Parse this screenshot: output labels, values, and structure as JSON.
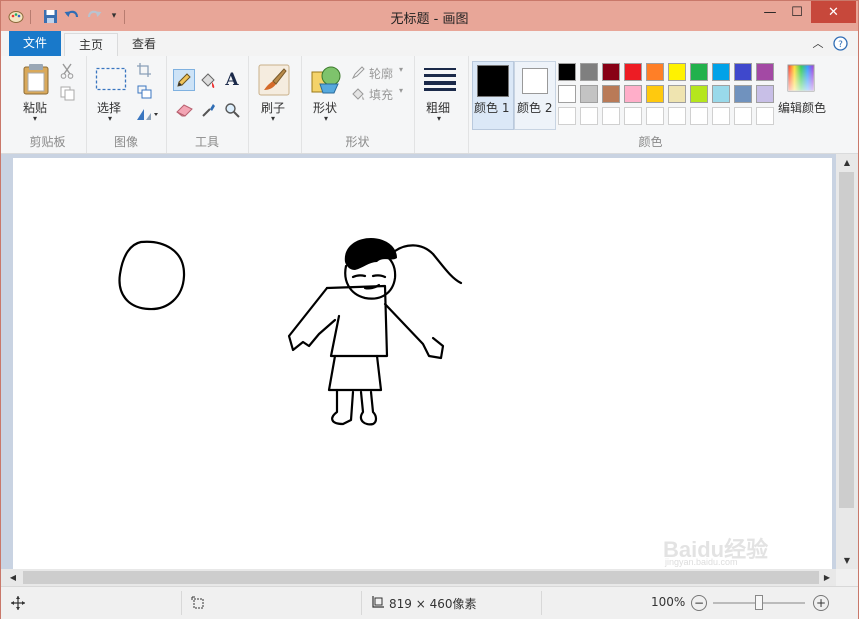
{
  "window": {
    "title": "无标题 - 画图"
  },
  "quick_access": {
    "app_icon": "paint-icon",
    "items": [
      "save-icon",
      "undo-icon",
      "redo-icon",
      "customize-icon"
    ]
  },
  "controls": {
    "minimize": "—",
    "maximize": "☐",
    "close": "✕"
  },
  "tabs": {
    "file": "文件",
    "home": "主页",
    "view": "查看"
  },
  "ribbon": {
    "clipboard": {
      "paste": "粘贴",
      "label": "剪贴板"
    },
    "image": {
      "select": "选择",
      "label": "图像"
    },
    "tools": {
      "label": "工具",
      "text_tool": "A"
    },
    "brushes": {
      "label": "刷子"
    },
    "shapes": {
      "shapes": "形状",
      "outline": "轮廓",
      "fill": "填充",
      "label": "形状"
    },
    "size": {
      "label": "粗细"
    },
    "colors": {
      "color1": "颜色 1",
      "color2": "颜色 2",
      "edit": "编辑颜色",
      "label": "颜色",
      "color1_value": "#000000",
      "color2_value": "#ffffff",
      "palette_row1": [
        "#000000",
        "#7f7f7f",
        "#880015",
        "#ed1c24",
        "#ff7f27",
        "#fff200",
        "#22b14c",
        "#00a2e8",
        "#3f48cc",
        "#a349a4"
      ],
      "palette_row2": [
        "#ffffff",
        "#c3c3c3",
        "#b97a57",
        "#ffaec9",
        "#ffc90e",
        "#efe4b0",
        "#b5e61d",
        "#99d9ea",
        "#7092be",
        "#c8bfe7"
      ]
    }
  },
  "status": {
    "size": "819 × 460像素",
    "zoom": "100%"
  },
  "watermark": {
    "text": "Baidu经验",
    "sub": "jingyan.baidu.com"
  }
}
